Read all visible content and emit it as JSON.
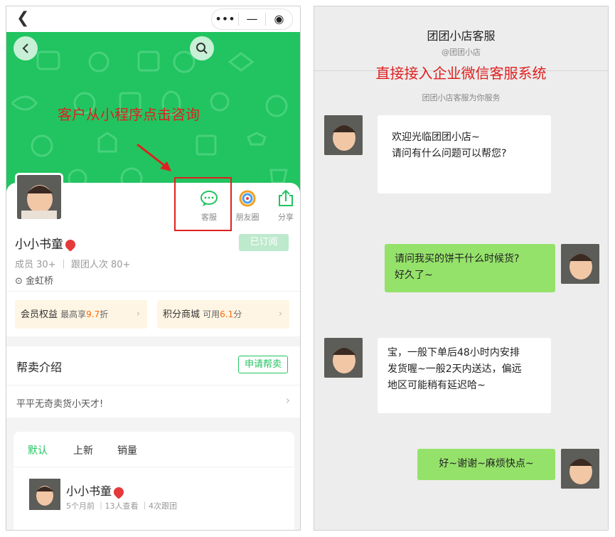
{
  "colors": {
    "brand_green": "#21c460",
    "annotation_red": "#e02020",
    "chat_bubble_green": "#95e26b",
    "perk_highlight": "#ff6a00"
  },
  "left": {
    "nav": {
      "back_icon": "chevron-left-icon",
      "capsule_more": "•••",
      "capsule_minimize": "—",
      "capsule_close": "◉"
    },
    "banner": {
      "annotation": "客户从小程序点击咨询"
    },
    "profile": {
      "name": "小小书童",
      "subscribe_label": "已订阅",
      "stats": "成员 30+ ｜ 跟团人次 80+",
      "location": "金虹桥",
      "actions": [
        {
          "label": "客服",
          "icon": "chat-bubble-icon"
        },
        {
          "label": "朋友圈",
          "icon": "moments-icon"
        },
        {
          "label": "分享",
          "icon": "share-icon"
        }
      ]
    },
    "perks": {
      "member": {
        "label": "会员权益",
        "prefix": "最高享",
        "value": "9.7",
        "suffix": "折"
      },
      "points": {
        "label": "积分商城",
        "prefix": "可用",
        "value": "6.1",
        "suffix": "分"
      }
    },
    "helper": {
      "title": "帮卖介绍",
      "apply_label": "申请帮卖",
      "description": "平平无奇卖货小天才!"
    },
    "feed": {
      "tabs": [
        "默认",
        "上新",
        "销量"
      ],
      "post": {
        "name": "小小书童",
        "meta": "5个月前 ｜13人查看 ｜4次跟团"
      }
    }
  },
  "right": {
    "title": "团团小店客服",
    "subtitle": "@团团小店",
    "headline": "直接接入企业微信客服系统",
    "notice": "团团小店客服为你服务",
    "messages": [
      {
        "from": "agent",
        "lines": [
          "欢迎光临团团小店~",
          "请问有什么问题可以帮您?"
        ]
      },
      {
        "from": "customer",
        "lines": [
          "请问我买的饼干什么时候货?",
          "好久了~"
        ]
      },
      {
        "from": "agent",
        "lines": [
          "宝，一般下单后48小时内安排",
          "发货喔~一般2天内送达，偏远",
          "地区可能稍有延迟哈~"
        ]
      },
      {
        "from": "customer",
        "lines": [
          "好~谢谢~麻烦快点~"
        ]
      }
    ]
  }
}
